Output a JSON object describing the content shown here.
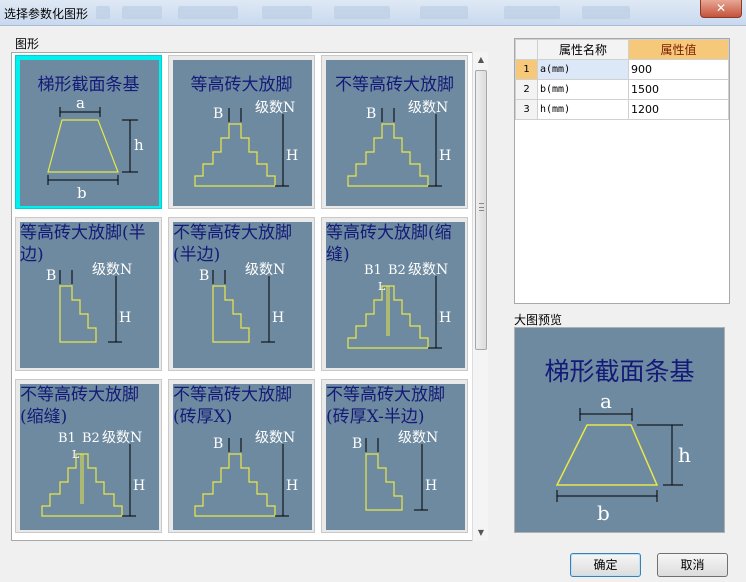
{
  "window": {
    "title": "选择参数化图形",
    "close_symbol": "✕"
  },
  "labels": {
    "shapes": "图形",
    "preview": "大图预览"
  },
  "tiles": [
    {
      "name": "梯形截面条基",
      "selected": true
    },
    {
      "name": "等高砖大放脚"
    },
    {
      "name": "不等高砖大放脚"
    },
    {
      "name": "等高砖大放脚(半边)"
    },
    {
      "name": "不等高砖大放脚(半边)"
    },
    {
      "name": "等高砖大放脚(缩缝)"
    },
    {
      "name": "不等高砖大放脚(缩缝)"
    },
    {
      "name": "不等高砖大放脚(砖厚X)"
    },
    {
      "name": "不等高砖大放脚(砖厚X-半边)"
    }
  ],
  "drawing_text": {
    "a": "a",
    "b": "b",
    "h": "h",
    "B": "B",
    "H": "H",
    "steps": "级数N",
    "B1": "B1",
    "B2": "B2",
    "L": "L"
  },
  "properties": {
    "header_name": "属性名称",
    "header_value": "属性值",
    "rows": [
      {
        "index": "1",
        "name": "a(mm)",
        "value": "900",
        "selected": true
      },
      {
        "index": "2",
        "name": "b(mm)",
        "value": "1500"
      },
      {
        "index": "3",
        "name": "h(mm)",
        "value": "1200"
      }
    ]
  },
  "preview": {
    "title": "梯形截面条基"
  },
  "buttons": {
    "ok": "确定",
    "cancel": "取消"
  },
  "colors": {
    "tile_bg": "#6e8aa0",
    "title_text": "#141a78",
    "selection": "#00f0f0",
    "line": "#e8e84a",
    "value_header": "#f6c87a"
  }
}
